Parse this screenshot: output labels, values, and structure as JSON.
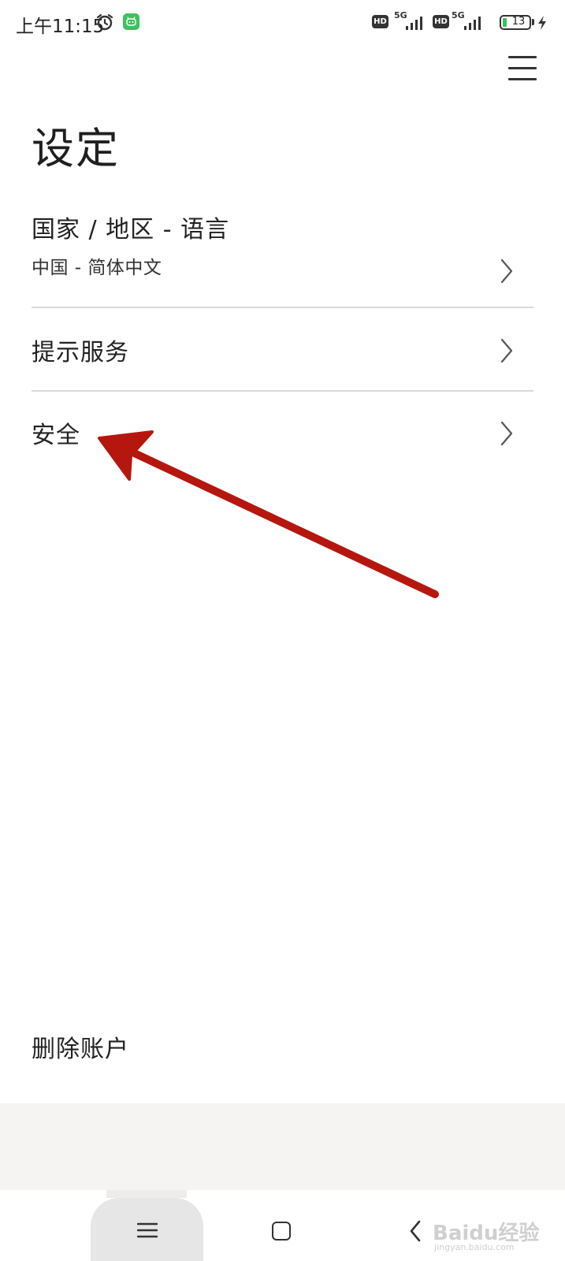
{
  "status_bar": {
    "time": "上午11:15",
    "hd_badge": "HD",
    "network_1": "5G",
    "network_2": "5G",
    "battery_level": "13",
    "battery_color": "#3cc25e"
  },
  "header": {
    "title": "设定",
    "menu_icon": "hamburger-menu-icon"
  },
  "settings": {
    "items": [
      {
        "label": "国家 / 地区 - 语言",
        "value": "中国 - 简体中文",
        "icon": "chevron-right-icon"
      },
      {
        "label": "提示服务",
        "icon": "chevron-right-icon"
      },
      {
        "label": "安全",
        "icon": "chevron-right-icon"
      }
    ],
    "delete_account": "删除账户"
  },
  "annotation": {
    "arrow_color": "#b5170f"
  },
  "navigation_bar": {
    "recents_icon": "recents-lines-icon",
    "home_icon": "home-square-icon",
    "back_icon": "back-chevron-icon"
  },
  "watermark": {
    "logo_text": "Baidu经验",
    "domain": "jingyan.baidu.com"
  }
}
